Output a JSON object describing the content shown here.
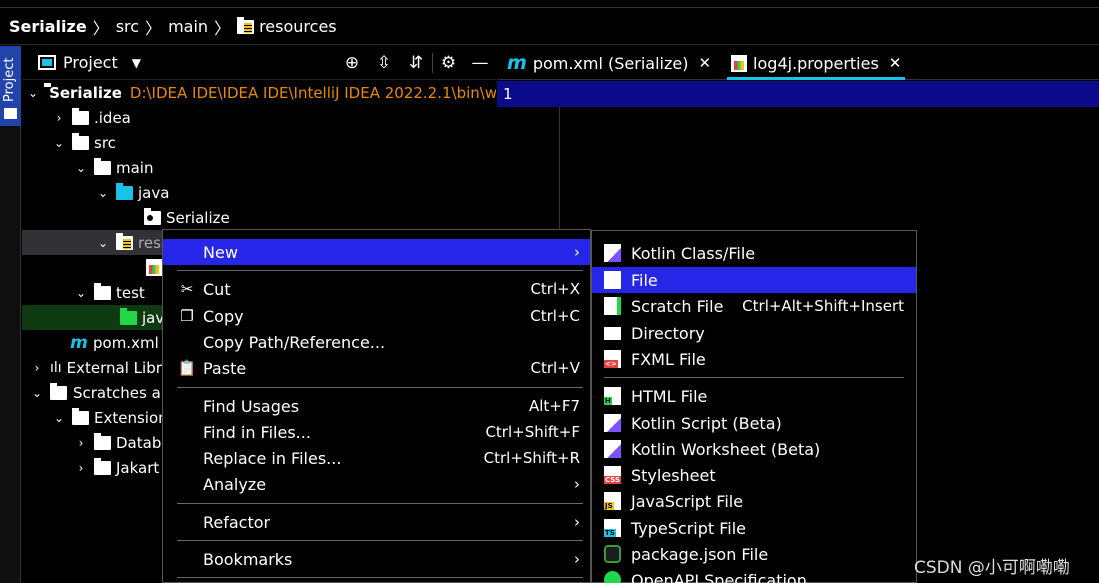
{
  "breadcrumb": {
    "root": "Serialize",
    "items": [
      "src",
      "main",
      "resources"
    ]
  },
  "sidebar_strip": {
    "label": "Project"
  },
  "project_panel": {
    "title": "Project",
    "tools": [
      "locate-icon",
      "expand-all-icon",
      "collapse-all-icon",
      "gear-icon",
      "minimize-icon"
    ]
  },
  "tree": [
    {
      "label": "Serialize",
      "path": "D:\\IDEA IDE\\IDEA IDE\\IntelliJ IDEA 2022.2.1\\bin\\w",
      "icon": "module-folder"
    },
    {
      "label": ".idea",
      "icon": "folder"
    },
    {
      "label": "src",
      "icon": "folder"
    },
    {
      "label": "main",
      "icon": "folder"
    },
    {
      "label": "java",
      "icon": "source-folder"
    },
    {
      "label": "Serialize",
      "icon": "package"
    },
    {
      "label": "res",
      "icon": "resource-folder"
    },
    {
      "label": "",
      "icon": "properties-file"
    },
    {
      "label": "test",
      "icon": "folder"
    },
    {
      "label": "jav",
      "icon": "test-source-folder"
    },
    {
      "label": "pom.xml",
      "icon": "maven"
    },
    {
      "label": "External Libr",
      "icon": "library"
    },
    {
      "label": "Scratches ar",
      "icon": "scratch"
    },
    {
      "label": "Extension",
      "icon": "folder"
    },
    {
      "label": "Datab",
      "icon": "folder"
    },
    {
      "label": "Jakart",
      "icon": "folder"
    }
  ],
  "tabs": [
    {
      "label": "pom.xml (Serialize)",
      "icon": "maven-icon",
      "close": "✕"
    },
    {
      "label": "log4j.properties",
      "icon": "properties-icon",
      "close": "✕"
    }
  ],
  "editor": {
    "line_number": "1"
  },
  "context_menu": {
    "items": [
      {
        "label": "New",
        "shortcut": "",
        "submenu": true
      },
      {
        "label": "Cut",
        "shortcut": "Ctrl+X",
        "icon": "scissors-icon"
      },
      {
        "label": "Copy",
        "shortcut": "Ctrl+C",
        "icon": "copy-icon"
      },
      {
        "label": "Copy Path/Reference...",
        "shortcut": ""
      },
      {
        "label": "Paste",
        "shortcut": "Ctrl+V",
        "icon": "paste-icon"
      },
      {
        "label": "Find Usages",
        "shortcut": "Alt+F7"
      },
      {
        "label": "Find in Files...",
        "shortcut": "Ctrl+Shift+F"
      },
      {
        "label": "Replace in Files...",
        "shortcut": "Ctrl+Shift+R"
      },
      {
        "label": "Analyze",
        "shortcut": "",
        "submenu": true
      },
      {
        "label": "Refactor",
        "shortcut": "",
        "submenu": true
      },
      {
        "label": "Bookmarks",
        "shortcut": "",
        "submenu": true
      }
    ],
    "arrow": "›"
  },
  "new_submenu": {
    "items": [
      {
        "label": "Kotlin Class/File",
        "shortcut": "",
        "icon": "kotlin-icon"
      },
      {
        "label": "File",
        "shortcut": "",
        "icon": "file-icon"
      },
      {
        "label": "Scratch File",
        "shortcut": "Ctrl+Alt+Shift+Insert",
        "icon": "scratch-file-icon"
      },
      {
        "label": "Directory",
        "shortcut": "",
        "icon": "folder-icon"
      },
      {
        "label": "FXML File",
        "shortcut": "",
        "icon": "fxml-icon"
      },
      {
        "label": "HTML File",
        "shortcut": "",
        "icon": "html-icon"
      },
      {
        "label": "Kotlin Script (Beta)",
        "shortcut": "",
        "icon": "kotlin-script-icon"
      },
      {
        "label": "Kotlin Worksheet (Beta)",
        "shortcut": "",
        "icon": "kotlin-worksheet-icon"
      },
      {
        "label": "Stylesheet",
        "shortcut": "",
        "icon": "css-icon"
      },
      {
        "label": "JavaScript File",
        "shortcut": "",
        "icon": "js-icon"
      },
      {
        "label": "TypeScript File",
        "shortcut": "",
        "icon": "ts-icon"
      },
      {
        "label": "package.json File",
        "shortcut": "",
        "icon": "nodejs-icon"
      },
      {
        "label": "OpenAPI Specification",
        "shortcut": "",
        "icon": "openapi-icon"
      }
    ]
  },
  "watermark": "CSDN @小可啊嘞嘞",
  "colors": {
    "accent": "#17c3e6",
    "highlight": "#2626e8",
    "current_line": "#0a0a8a",
    "path_text": "#e68a00"
  }
}
